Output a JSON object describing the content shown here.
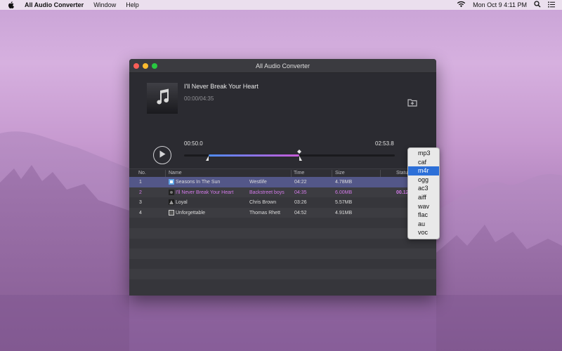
{
  "menubar": {
    "app_name": "All Audio Converter",
    "menu_window": "Window",
    "menu_help": "Help",
    "datetime": "Mon Oct 9  4:11 PM"
  },
  "window": {
    "title": "All Audio Converter"
  },
  "player": {
    "song_title": "I'll Never Break Your Heart",
    "playback_time": "00:00/04:35",
    "start_time": "00:50.0",
    "end_time": "02:53.8",
    "selection_start_fraction": 0.117,
    "selection_end_fraction": 0.546
  },
  "table": {
    "headers": {
      "no": "No.",
      "name": "Name",
      "time": "Time",
      "size": "Size",
      "status": "Status"
    },
    "rows": [
      {
        "no": "1",
        "name": "Seasons In The Sun",
        "artist": "Westlife",
        "time": "04:22",
        "size": "4.78MB",
        "status": ""
      },
      {
        "no": "2",
        "name": "I'll Never Break Your Heart",
        "artist": "Backstreet boys",
        "time": "04:35",
        "size": "6.00MB",
        "status": "00.12"
      },
      {
        "no": "3",
        "name": "Loyal",
        "artist": "Chris Brown",
        "time": "03:26",
        "size": "5.57MB",
        "status": ""
      },
      {
        "no": "4",
        "name": "Unforgettable",
        "artist": "Thomas Rhett",
        "time": "04:52",
        "size": "4.91MB",
        "status": ""
      }
    ]
  },
  "format_menu": {
    "options": [
      "mp3",
      "caf",
      "m4r",
      "ogg",
      "ac3",
      "aiff",
      "wav",
      "flac",
      "au",
      "voc"
    ],
    "selected": "m4r"
  },
  "colors": {
    "selection_row": "#535788",
    "playing_text": "#d27ae8",
    "menu_highlight": "#2c6fd8",
    "progress_start": "#4e8cf3",
    "progress_end": "#c85bd8"
  }
}
